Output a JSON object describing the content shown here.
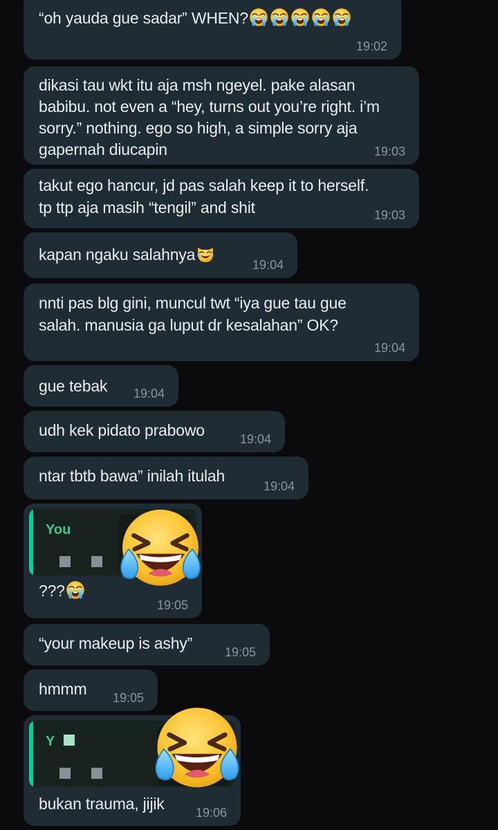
{
  "messages": [
    {
      "text": "“oh yauda gue sadar” WHEN?",
      "emoji": "loudly-crying-face-x5",
      "time": "19:02"
    },
    {
      "text": "dikasi tau wkt itu aja msh ngeyel. pake alasan\nbabibu. not even a “hey, turns out you’re right. i’m\nsorry.” nothing. ego so high, a simple sorry aja\ngapernah diucapin",
      "time": "19:03"
    },
    {
      "text": "takut ego hancur, jd pas salah keep it to herself.\ntp ttp aja masih “tengil” and shit",
      "time": "19:03"
    },
    {
      "text": "kapan ngaku salahnya",
      "emoji": "cat-tears-of-joy",
      "time": "19:04"
    },
    {
      "text": "nnti pas blg gini, muncul twt “iya gue tau gue\nsalah. manusia ga luput dr kesalahan” OK?",
      "time": "19:04"
    },
    {
      "text": "gue tebak",
      "time": "19:04"
    },
    {
      "text": "udh kek pidato prabowo",
      "time": "19:04"
    },
    {
      "text": "ntar tbtb bawa” inilah itulah",
      "time": "19:04"
    },
    {
      "quote_name": "You",
      "text": "???",
      "emoji": "loudly-crying-face",
      "time": "19:05",
      "sticker": "face-with-tears-of-joy"
    },
    {
      "text": "“your makeup is ashy”",
      "time": "19:05"
    },
    {
      "text": "hmmm",
      "time": "19:05"
    },
    {
      "quote_name": "Y",
      "text": "bukan trauma, jijik",
      "time": "19:06",
      "sticker": "face-with-tears-of-joy"
    }
  ],
  "colors": {
    "background": "#0b0b0d",
    "bubble": "#202c33",
    "text": "#e9edef",
    "time": "#8696a0",
    "quote_accent": "#06cf9c"
  }
}
